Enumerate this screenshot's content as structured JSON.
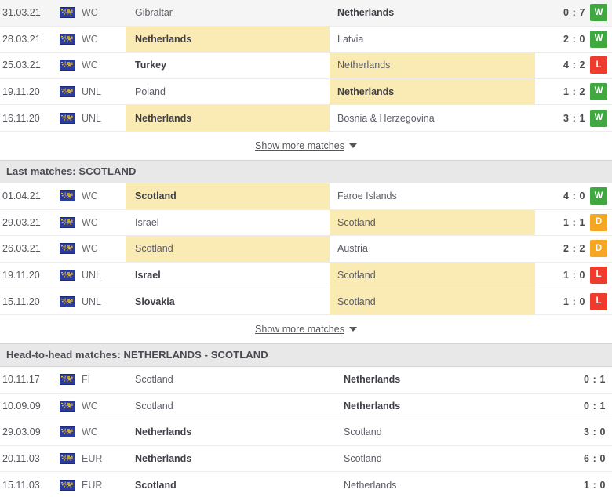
{
  "colors": {
    "win": "#3fa93f",
    "draw": "#f5a623",
    "loss": "#ef3b2d",
    "highlight": "#faeab4",
    "section_header_bg": "#e8e8e8"
  },
  "show_more_label": "Show more matches",
  "icons": {
    "globe": "globe-icon",
    "caret": "chevron-down-icon"
  },
  "sections": [
    {
      "id": "last-matches-netherlands",
      "header": null,
      "has_result_badge": true,
      "show_more": true,
      "rows": [
        {
          "date": "31.03.21",
          "competition": "WC",
          "home": "Gibraltar",
          "away": "Netherlands",
          "home_bold": false,
          "away_bold": true,
          "home_highlight": false,
          "away_highlight": false,
          "score": "0 : 7",
          "result": "W",
          "shaded": true
        },
        {
          "date": "28.03.21",
          "competition": "WC",
          "home": "Netherlands",
          "away": "Latvia",
          "home_bold": true,
          "away_bold": false,
          "home_highlight": true,
          "away_highlight": false,
          "score": "2 : 0",
          "result": "W",
          "shaded": false
        },
        {
          "date": "25.03.21",
          "competition": "WC",
          "home": "Turkey",
          "away": "Netherlands",
          "home_bold": true,
          "away_bold": false,
          "home_highlight": false,
          "away_highlight": true,
          "score": "4 : 2",
          "result": "L",
          "shaded": false
        },
        {
          "date": "19.11.20",
          "competition": "UNL",
          "home": "Poland",
          "away": "Netherlands",
          "home_bold": false,
          "away_bold": true,
          "home_highlight": false,
          "away_highlight": true,
          "score": "1 : 2",
          "result": "W",
          "shaded": false
        },
        {
          "date": "16.11.20",
          "competition": "UNL",
          "home": "Netherlands",
          "away": "Bosnia & Herzegovina",
          "home_bold": true,
          "away_bold": false,
          "home_highlight": true,
          "away_highlight": false,
          "score": "3 : 1",
          "result": "W",
          "shaded": false
        }
      ]
    },
    {
      "id": "last-matches-scotland",
      "header": "Last matches: SCOTLAND",
      "has_result_badge": true,
      "show_more": true,
      "rows": [
        {
          "date": "01.04.21",
          "competition": "WC",
          "home": "Scotland",
          "away": "Faroe Islands",
          "home_bold": true,
          "away_bold": false,
          "home_highlight": true,
          "away_highlight": false,
          "score": "4 : 0",
          "result": "W",
          "shaded": false
        },
        {
          "date": "29.03.21",
          "competition": "WC",
          "home": "Israel",
          "away": "Scotland",
          "home_bold": false,
          "away_bold": false,
          "home_highlight": false,
          "away_highlight": true,
          "score": "1 : 1",
          "result": "D",
          "shaded": false
        },
        {
          "date": "26.03.21",
          "competition": "WC",
          "home": "Scotland",
          "away": "Austria",
          "home_bold": false,
          "away_bold": false,
          "home_highlight": true,
          "away_highlight": false,
          "score": "2 : 2",
          "result": "D",
          "shaded": false
        },
        {
          "date": "19.11.20",
          "competition": "UNL",
          "home": "Israel",
          "away": "Scotland",
          "home_bold": true,
          "away_bold": false,
          "home_highlight": false,
          "away_highlight": true,
          "score": "1 : 0",
          "result": "L",
          "shaded": false
        },
        {
          "date": "15.11.20",
          "competition": "UNL",
          "home": "Slovakia",
          "away": "Scotland",
          "home_bold": true,
          "away_bold": false,
          "home_highlight": false,
          "away_highlight": true,
          "score": "1 : 0",
          "result": "L",
          "shaded": false
        }
      ]
    },
    {
      "id": "head-to-head",
      "header": "Head-to-head matches: NETHERLANDS - SCOTLAND",
      "has_result_badge": false,
      "show_more": false,
      "rows": [
        {
          "date": "10.11.17",
          "competition": "FI",
          "home": "Scotland",
          "away": "Netherlands",
          "home_bold": false,
          "away_bold": true,
          "home_highlight": false,
          "away_highlight": false,
          "score": "0 : 1",
          "result": null,
          "shaded": false
        },
        {
          "date": "10.09.09",
          "competition": "WC",
          "home": "Scotland",
          "away": "Netherlands",
          "home_bold": false,
          "away_bold": true,
          "home_highlight": false,
          "away_highlight": false,
          "score": "0 : 1",
          "result": null,
          "shaded": false
        },
        {
          "date": "29.03.09",
          "competition": "WC",
          "home": "Netherlands",
          "away": "Scotland",
          "home_bold": true,
          "away_bold": false,
          "home_highlight": false,
          "away_highlight": false,
          "score": "3 : 0",
          "result": null,
          "shaded": false
        },
        {
          "date": "20.11.03",
          "competition": "EUR",
          "home": "Netherlands",
          "away": "Scotland",
          "home_bold": true,
          "away_bold": false,
          "home_highlight": false,
          "away_highlight": false,
          "score": "6 : 0",
          "result": null,
          "shaded": false
        },
        {
          "date": "15.11.03",
          "competition": "EUR",
          "home": "Scotland",
          "away": "Netherlands",
          "home_bold": true,
          "away_bold": false,
          "home_highlight": false,
          "away_highlight": false,
          "score": "1 : 0",
          "result": null,
          "shaded": false
        }
      ]
    }
  ]
}
